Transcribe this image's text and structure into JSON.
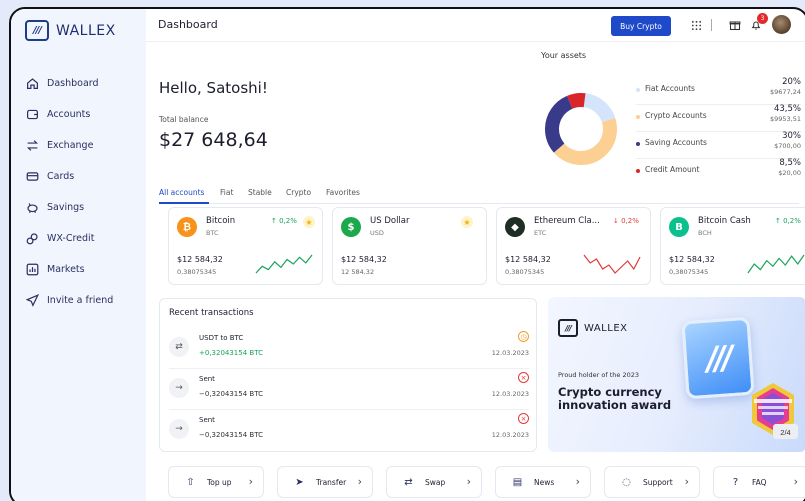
{
  "app": {
    "name": "WALLEX",
    "logo_glyph": "///"
  },
  "sidebar": {
    "items": [
      {
        "label": "Dashboard",
        "icon": "home-icon"
      },
      {
        "label": "Accounts",
        "icon": "wallet-icon"
      },
      {
        "label": "Exchange",
        "icon": "exchange-icon"
      },
      {
        "label": "Cards",
        "icon": "card-icon"
      },
      {
        "label": "Savings",
        "icon": "piggy-bank-icon"
      },
      {
        "label": "WX-Credit",
        "icon": "credit-icon"
      },
      {
        "label": "Markets",
        "icon": "chart-icon"
      },
      {
        "label": "Invite a friend",
        "icon": "send-icon"
      }
    ]
  },
  "header": {
    "title": "Dashboard",
    "buy_label": "Buy Crypto",
    "notification_count": "3"
  },
  "overview": {
    "greeting": "Hello, Satoshi!",
    "balance_label": "Total balance",
    "balance_value": "$27 648,64"
  },
  "assets": {
    "title": "Your assets",
    "items": [
      {
        "name": "Fiat Accounts",
        "pct": "20%",
        "amount": "$9677,24",
        "color": "#d3e4fb",
        "share": 0.2
      },
      {
        "name": "Crypto Accounts",
        "pct": "43,5%",
        "amount": "$9953,51",
        "color": "#fccf92",
        "share": 0.435
      },
      {
        "name": "Saving Accounts",
        "pct": "30%",
        "amount": "$700,00",
        "color": "#3a3a8a",
        "share": 0.3
      },
      {
        "name": "Credit Amount",
        "pct": "8,5%",
        "amount": "$20,00",
        "color": "#d8262b",
        "share": 0.085
      }
    ]
  },
  "tabs": [
    "All accounts",
    "Fiat",
    "Stable",
    "Crypto",
    "Favorites"
  ],
  "cards": [
    {
      "name": "Bitcoin",
      "ticker": "BTC",
      "change": "↑ 0,2%",
      "direction": "up",
      "starred": true,
      "balance": "$12 584,32",
      "sub": "0,38075345",
      "color": "#f7931a",
      "glyph": "₿",
      "spark": [
        6,
        12,
        9,
        16,
        11,
        18,
        14,
        20,
        15,
        22
      ]
    },
    {
      "name": "US Dollar",
      "ticker": "USD",
      "change": "",
      "direction": "none",
      "starred": true,
      "balance": "$12 584,32",
      "sub": "12 584,32",
      "color": "#1ba94c",
      "glyph": "$",
      "spark": []
    },
    {
      "name": "Ethereum Cla...",
      "ticker": "ETC",
      "change": "↓ 0,2%",
      "direction": "down",
      "starred": false,
      "balance": "$12 584,32",
      "sub": "0,38075345",
      "color": "#1d2f25",
      "glyph": "◆",
      "spark": [
        14,
        10,
        12,
        7,
        9,
        5,
        8,
        11,
        7,
        13
      ]
    },
    {
      "name": "Bitcoin Cash",
      "ticker": "BCH",
      "change": "↑ 0,2%",
      "direction": "up",
      "starred": false,
      "balance": "$12 584,32",
      "sub": "0,38075345",
      "color": "#0ac18e",
      "glyph": "B",
      "spark": [
        6,
        14,
        9,
        17,
        12,
        19,
        13,
        21,
        14,
        22
      ]
    }
  ],
  "transactions": {
    "title": "Recent transactions",
    "items": [
      {
        "name": "USDT to BTC",
        "amount": "+0,32043154 BTC",
        "date": "12.03.2023",
        "status": "pending",
        "status_glyph": "◷",
        "icon_glyph": "⇄",
        "positive": true
      },
      {
        "name": "Sent",
        "amount": "−0,32043154 BTC",
        "date": "12.03.2023",
        "status": "failed",
        "status_glyph": "×",
        "icon_glyph": "→",
        "positive": false
      },
      {
        "name": "Sent",
        "amount": "−0,32043154 BTC",
        "date": "12.03.2023",
        "status": "failed",
        "status_glyph": "×",
        "icon_glyph": "→",
        "positive": false
      }
    ]
  },
  "promo": {
    "brand": "WALLEX",
    "subtitle": "Proud holder of the 2023",
    "title": "Crypto currency innovation award",
    "badge_text": "FINTECH BREAKTHROUGH AWARD",
    "page": "2/4"
  },
  "quick_actions": [
    {
      "label": "Top up",
      "icon": "top-up-icon",
      "glyph": "⇧"
    },
    {
      "label": "Transfer",
      "icon": "transfer-icon",
      "glyph": "➤"
    },
    {
      "label": "Swap",
      "icon": "swap-icon",
      "glyph": "⇄"
    },
    {
      "label": "News",
      "icon": "news-icon",
      "glyph": "▤"
    },
    {
      "label": "Support",
      "icon": "support-icon",
      "glyph": "◌"
    },
    {
      "label": "FAQ",
      "icon": "faq-icon",
      "glyph": "?"
    }
  ]
}
